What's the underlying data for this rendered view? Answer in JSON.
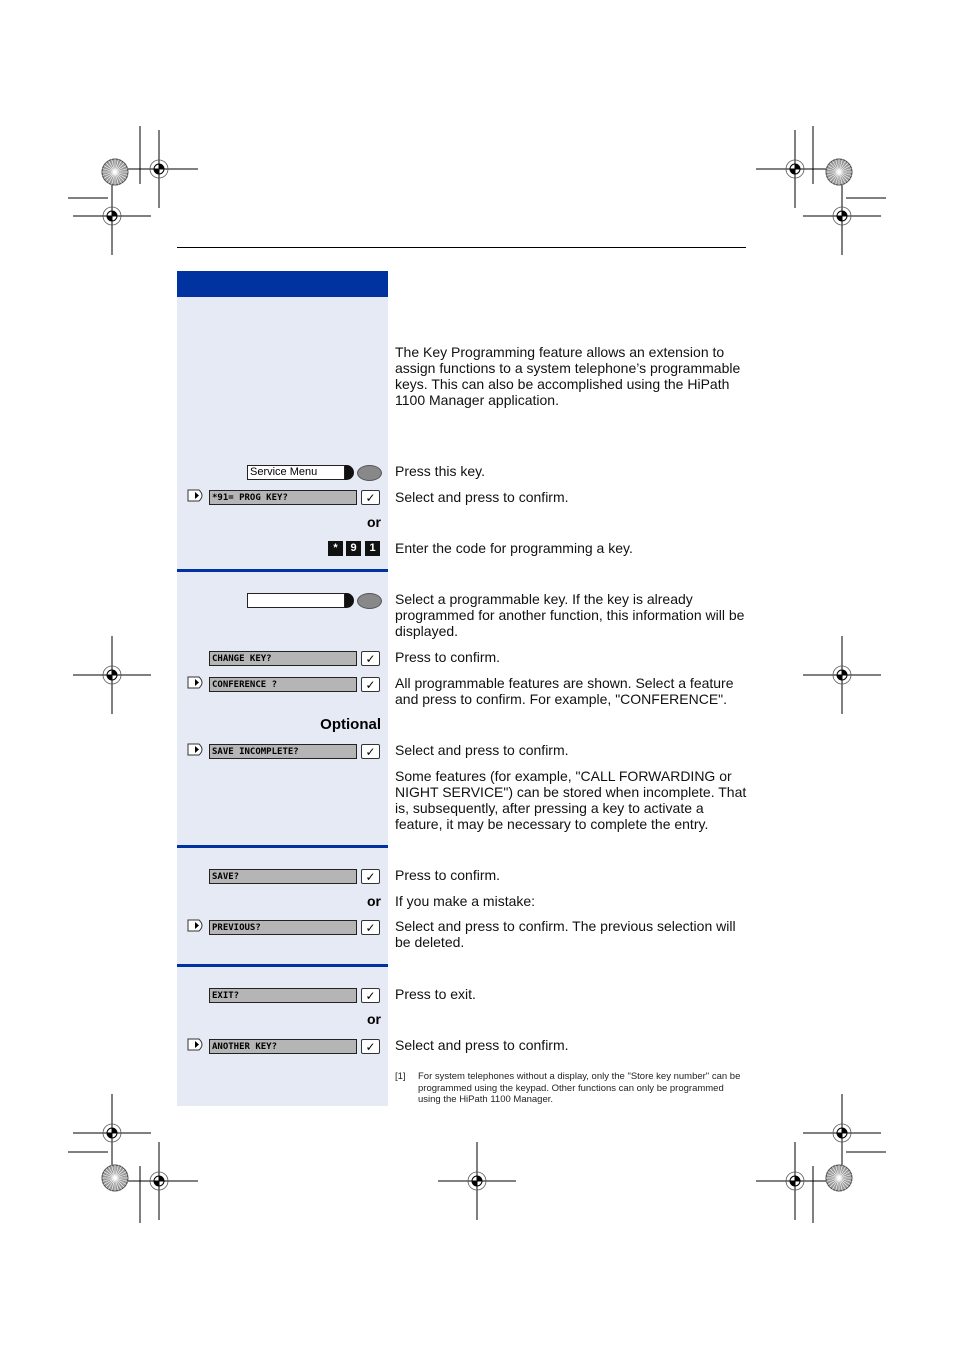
{
  "intro": "The Key Programming feature allows an extension to assign functions to a system telephone’s programmable keys. This can also be accomplished using the HiPath 1100 Manager application.",
  "service_menu_label": "Service Menu",
  "displays": {
    "prog_key": "*91= PROG KEY?",
    "change_key": "CHANGE KEY?",
    "conference": "CONFERENCE ?",
    "save_incomplete": "SAVE INCOMPLETE?",
    "save": "SAVE?",
    "previous": "PREVIOUS?",
    "exit": "EXIT?",
    "another_key": "ANOTHER KEY?"
  },
  "keys": [
    "*",
    "9",
    "1"
  ],
  "or": "or",
  "optional": "Optional",
  "check": "✓",
  "steps": {
    "press_key": "Press this key.",
    "select_confirm": "Select and press to confirm.",
    "enter_code": "Enter the code for programming a key.",
    "select_prog_key": "Select a programmable key. If the key is already programmed for another function, this information will be displayed.",
    "press_confirm": "Press to confirm.",
    "all_features": "All programmable features are shown. Select a feature and press to confirm. For example, \"CONFERENCE\".",
    "select_confirm2": "Select and press to confirm.",
    "some_features": "Some features (for example, \"CALL FORWARDING or NIGHT SERVICE\") can be stored when incomplete. That is, subsequently, after pressing a key to activate a feature, it may be necessary to complete the entry.",
    "press_confirm2": "Press to confirm.",
    "mistake": "If you make a mistake:",
    "previous_deleted": "Select and press to confirm. The previous selection will be deleted.",
    "press_exit": "Press to exit.",
    "select_confirm3": "Select and press to confirm."
  },
  "footnote": {
    "num": "[1]",
    "text": "For system telephones without a display, only the \"Store key number\" can be programmed using the keypad. Other functions can only be programmed using the HiPath 1100 Manager."
  },
  "colors": {
    "accent": "#0033a0",
    "panel": "#e6eaf5",
    "display": "#b5b5b5"
  }
}
